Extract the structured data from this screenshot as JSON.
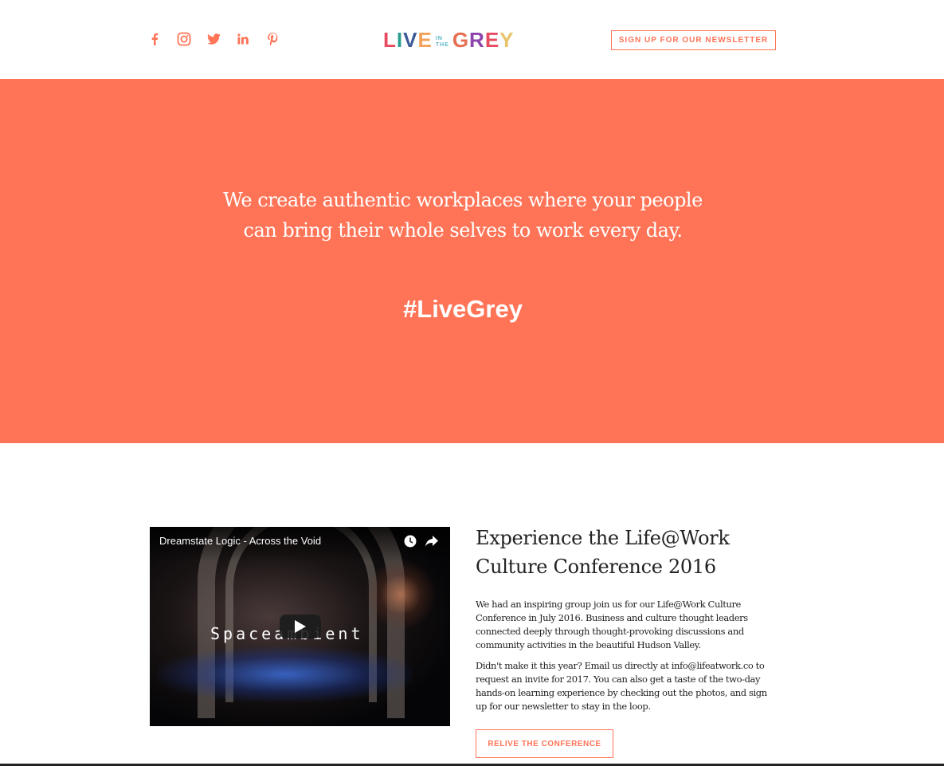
{
  "header": {
    "social_icons": [
      "facebook-icon",
      "instagram-icon",
      "twitter-icon",
      "linkedin-icon",
      "pinterest-icon"
    ],
    "logo": {
      "part1": "LIVE",
      "small_top": "IN",
      "small_bottom": "THE",
      "part2": "GREY"
    },
    "newsletter_label": "SIGN UP FOR OUR NEWSLETTER"
  },
  "hero": {
    "line1": "We create authentic workplaces where your people",
    "line2": "can bring their whole selves to work every day.",
    "hashtag": "#LiveGrey"
  },
  "video": {
    "title": "Dreamstate Logic - Across the Void",
    "overlay_text": "Spaceambient"
  },
  "conference": {
    "title_line1": "Experience the Life@Work",
    "title_line2": "Culture Conference 2016",
    "paragraph1": "We had an inspiring group join us for our Life@Work Culture Conference in July 2016. Business and culture thought leaders connected deeply through thought-provoking discussions and community activities in the beautiful Hudson Valley.",
    "paragraph2": "Didn't make it this year? Email us directly at info@lifeatwork.co to request an invite for 2017. You can also get a taste of the two-day hands-on learning experience by checking out the photos, and sign up for our newsletter to stay in the loop.",
    "button_label": "RELIVE THE CONFERENCE"
  },
  "colors": {
    "accent": "#ff7457",
    "text": "#222222",
    "background": "#ffffff"
  }
}
